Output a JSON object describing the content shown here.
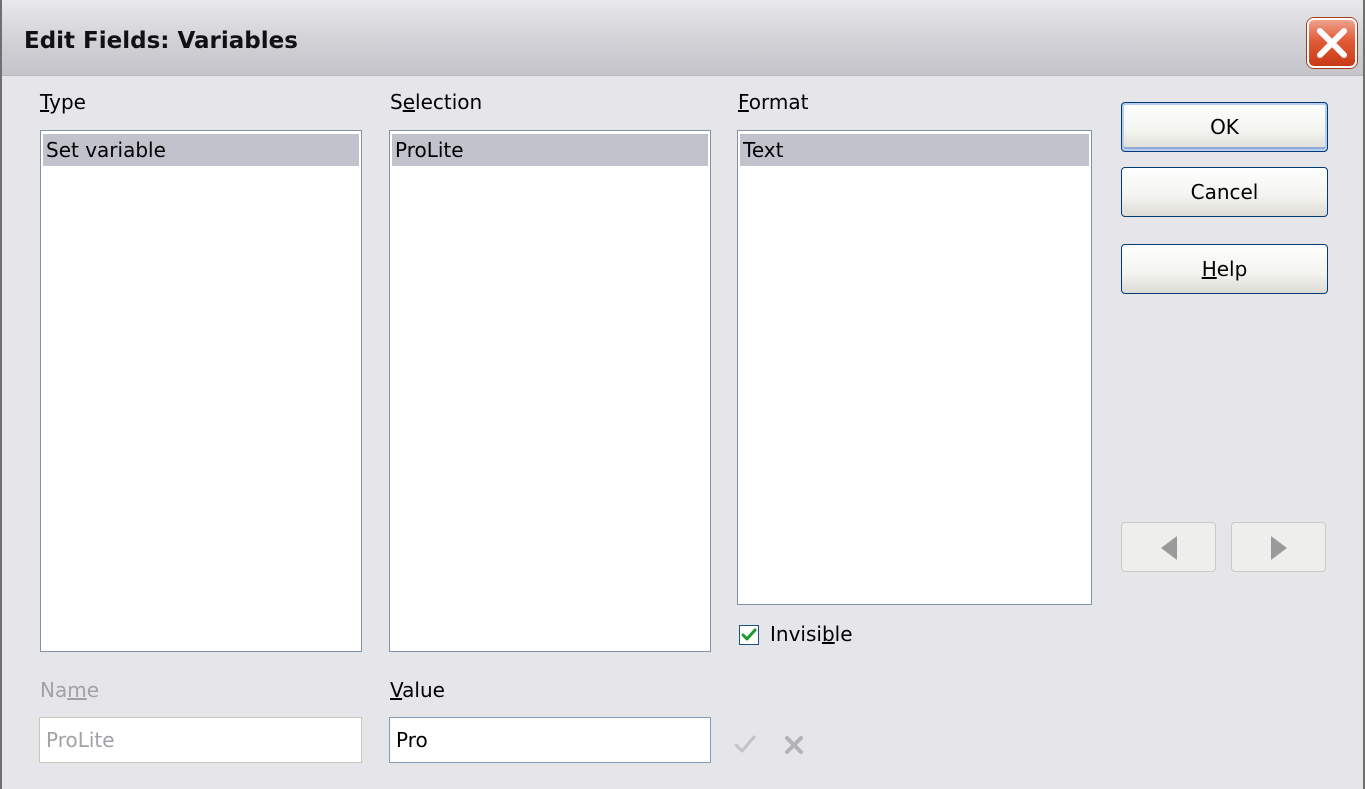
{
  "window": {
    "title": "Edit Fields: Variables",
    "close_icon": "close-icon"
  },
  "type_column": {
    "label": "Type",
    "items": [
      "Set variable"
    ]
  },
  "selection_column": {
    "label": "Selection",
    "items": [
      "ProLite"
    ]
  },
  "format_column": {
    "label": "Format",
    "items": [
      "Text"
    ]
  },
  "invisible_checkbox": {
    "label": "Invisible",
    "checked": true
  },
  "name_field": {
    "label": "Name",
    "value": "ProLite",
    "enabled": false
  },
  "value_field": {
    "label": "Value",
    "value": "Pro"
  },
  "buttons": {
    "ok": "OK",
    "cancel": "Cancel",
    "help": "Help"
  },
  "icons": {
    "apply": "checkmark-icon",
    "delete": "delete-x-icon",
    "previous": "left-arrow-icon",
    "next": "right-arrow-icon"
  },
  "colors": {
    "selection_highlight": "#c1c2cc",
    "close_button": "#e15b37",
    "checkmark": "#1f9b2e"
  }
}
